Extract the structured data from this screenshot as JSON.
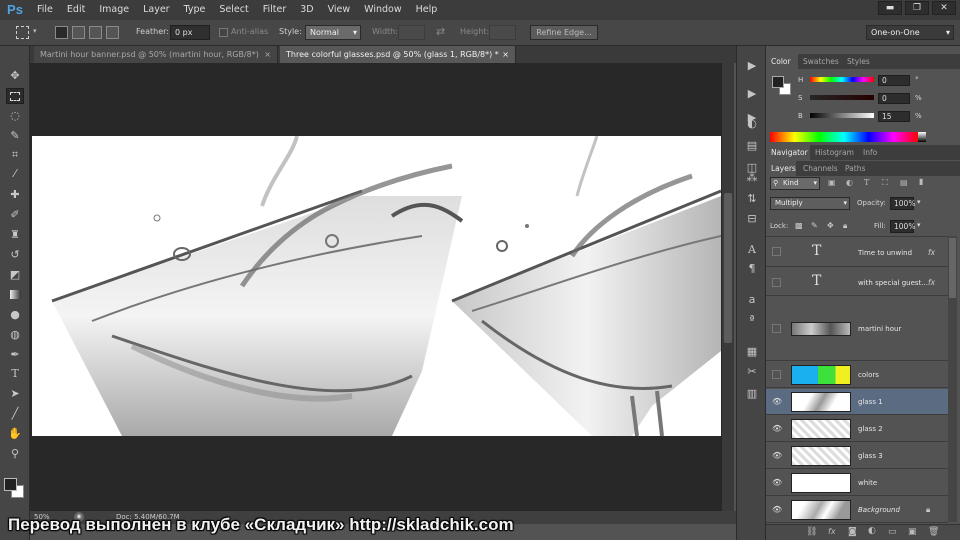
{
  "app": {
    "logo": "Ps"
  },
  "menu": [
    "File",
    "Edit",
    "Image",
    "Layer",
    "Type",
    "Select",
    "Filter",
    "3D",
    "View",
    "Window",
    "Help"
  ],
  "window_controls": {
    "minimize": "▬",
    "restore": "❐",
    "close": "✕"
  },
  "options": {
    "feather_label": "Feather:",
    "feather_value": "0 px",
    "antialias_label": "Anti-alias",
    "style_label": "Style:",
    "style_value": "Normal",
    "width_label": "Width:",
    "height_label": "Height:",
    "refine_edge": "Refine Edge...",
    "workspace": "One-on-One"
  },
  "tabs": [
    {
      "label": "Martini hour banner.psd @ 50% (martini hour, RGB/8*)",
      "close": "×"
    },
    {
      "label": "Three colorful glasses.psd @ 50% (glass 1, RGB/8*) *",
      "close": "×"
    }
  ],
  "status": {
    "zoom": "50%",
    "doc": "Doc: 5.40M/60.7M"
  },
  "color_panel": {
    "tabs": [
      "Color",
      "Swatches",
      "Styles"
    ],
    "h_label": "H",
    "h_value": "0",
    "h_unit": "°",
    "s_label": "S",
    "s_value": "0",
    "s_unit": "%",
    "b_label": "B",
    "b_value": "15",
    "b_unit": "%"
  },
  "nav_panel": {
    "tabs": [
      "Navigator",
      "Histogram",
      "Info"
    ]
  },
  "layers_panel": {
    "tabs": [
      "Layers",
      "Channels",
      "Paths"
    ],
    "filter_kind": "Kind",
    "blend_mode": "Multiply",
    "opacity_label": "Opacity:",
    "opacity_value": "100%",
    "lock_label": "Lock:",
    "fill_label": "Fill:",
    "fill_value": "100%",
    "layers": [
      {
        "name": "Time to unwind",
        "kind": "text",
        "visible": false,
        "fx": "fx"
      },
      {
        "name": "with special guest...",
        "kind": "text",
        "visible": false,
        "fx": "fx"
      },
      {
        "name": "martini hour",
        "kind": "image",
        "visible": false
      },
      {
        "name": "colors",
        "kind": "colors",
        "visible": false
      },
      {
        "name": "glass 1",
        "kind": "image",
        "visible": true,
        "selected": true
      },
      {
        "name": "glass 2",
        "kind": "image",
        "visible": true
      },
      {
        "name": "glass 3",
        "kind": "image",
        "visible": true
      },
      {
        "name": "white",
        "kind": "white",
        "visible": true
      },
      {
        "name": "Background",
        "kind": "image",
        "visible": true
      }
    ]
  },
  "tools": [
    "move-tool",
    "marquee-tool",
    "lasso-tool",
    "quick-selection-tool",
    "crop-tool",
    "eyedropper-tool",
    "healing-brush-tool",
    "brush-tool",
    "clone-stamp-tool",
    "history-brush-tool",
    "eraser-tool",
    "gradient-tool",
    "blur-tool",
    "dodge-tool",
    "pen-tool",
    "type-tool",
    "path-selection-tool",
    "shape-tool",
    "hand-tool",
    "zoom-tool"
  ],
  "watermark": "Перевод выполнен в клубе «Складчик» http://skladchik.com"
}
